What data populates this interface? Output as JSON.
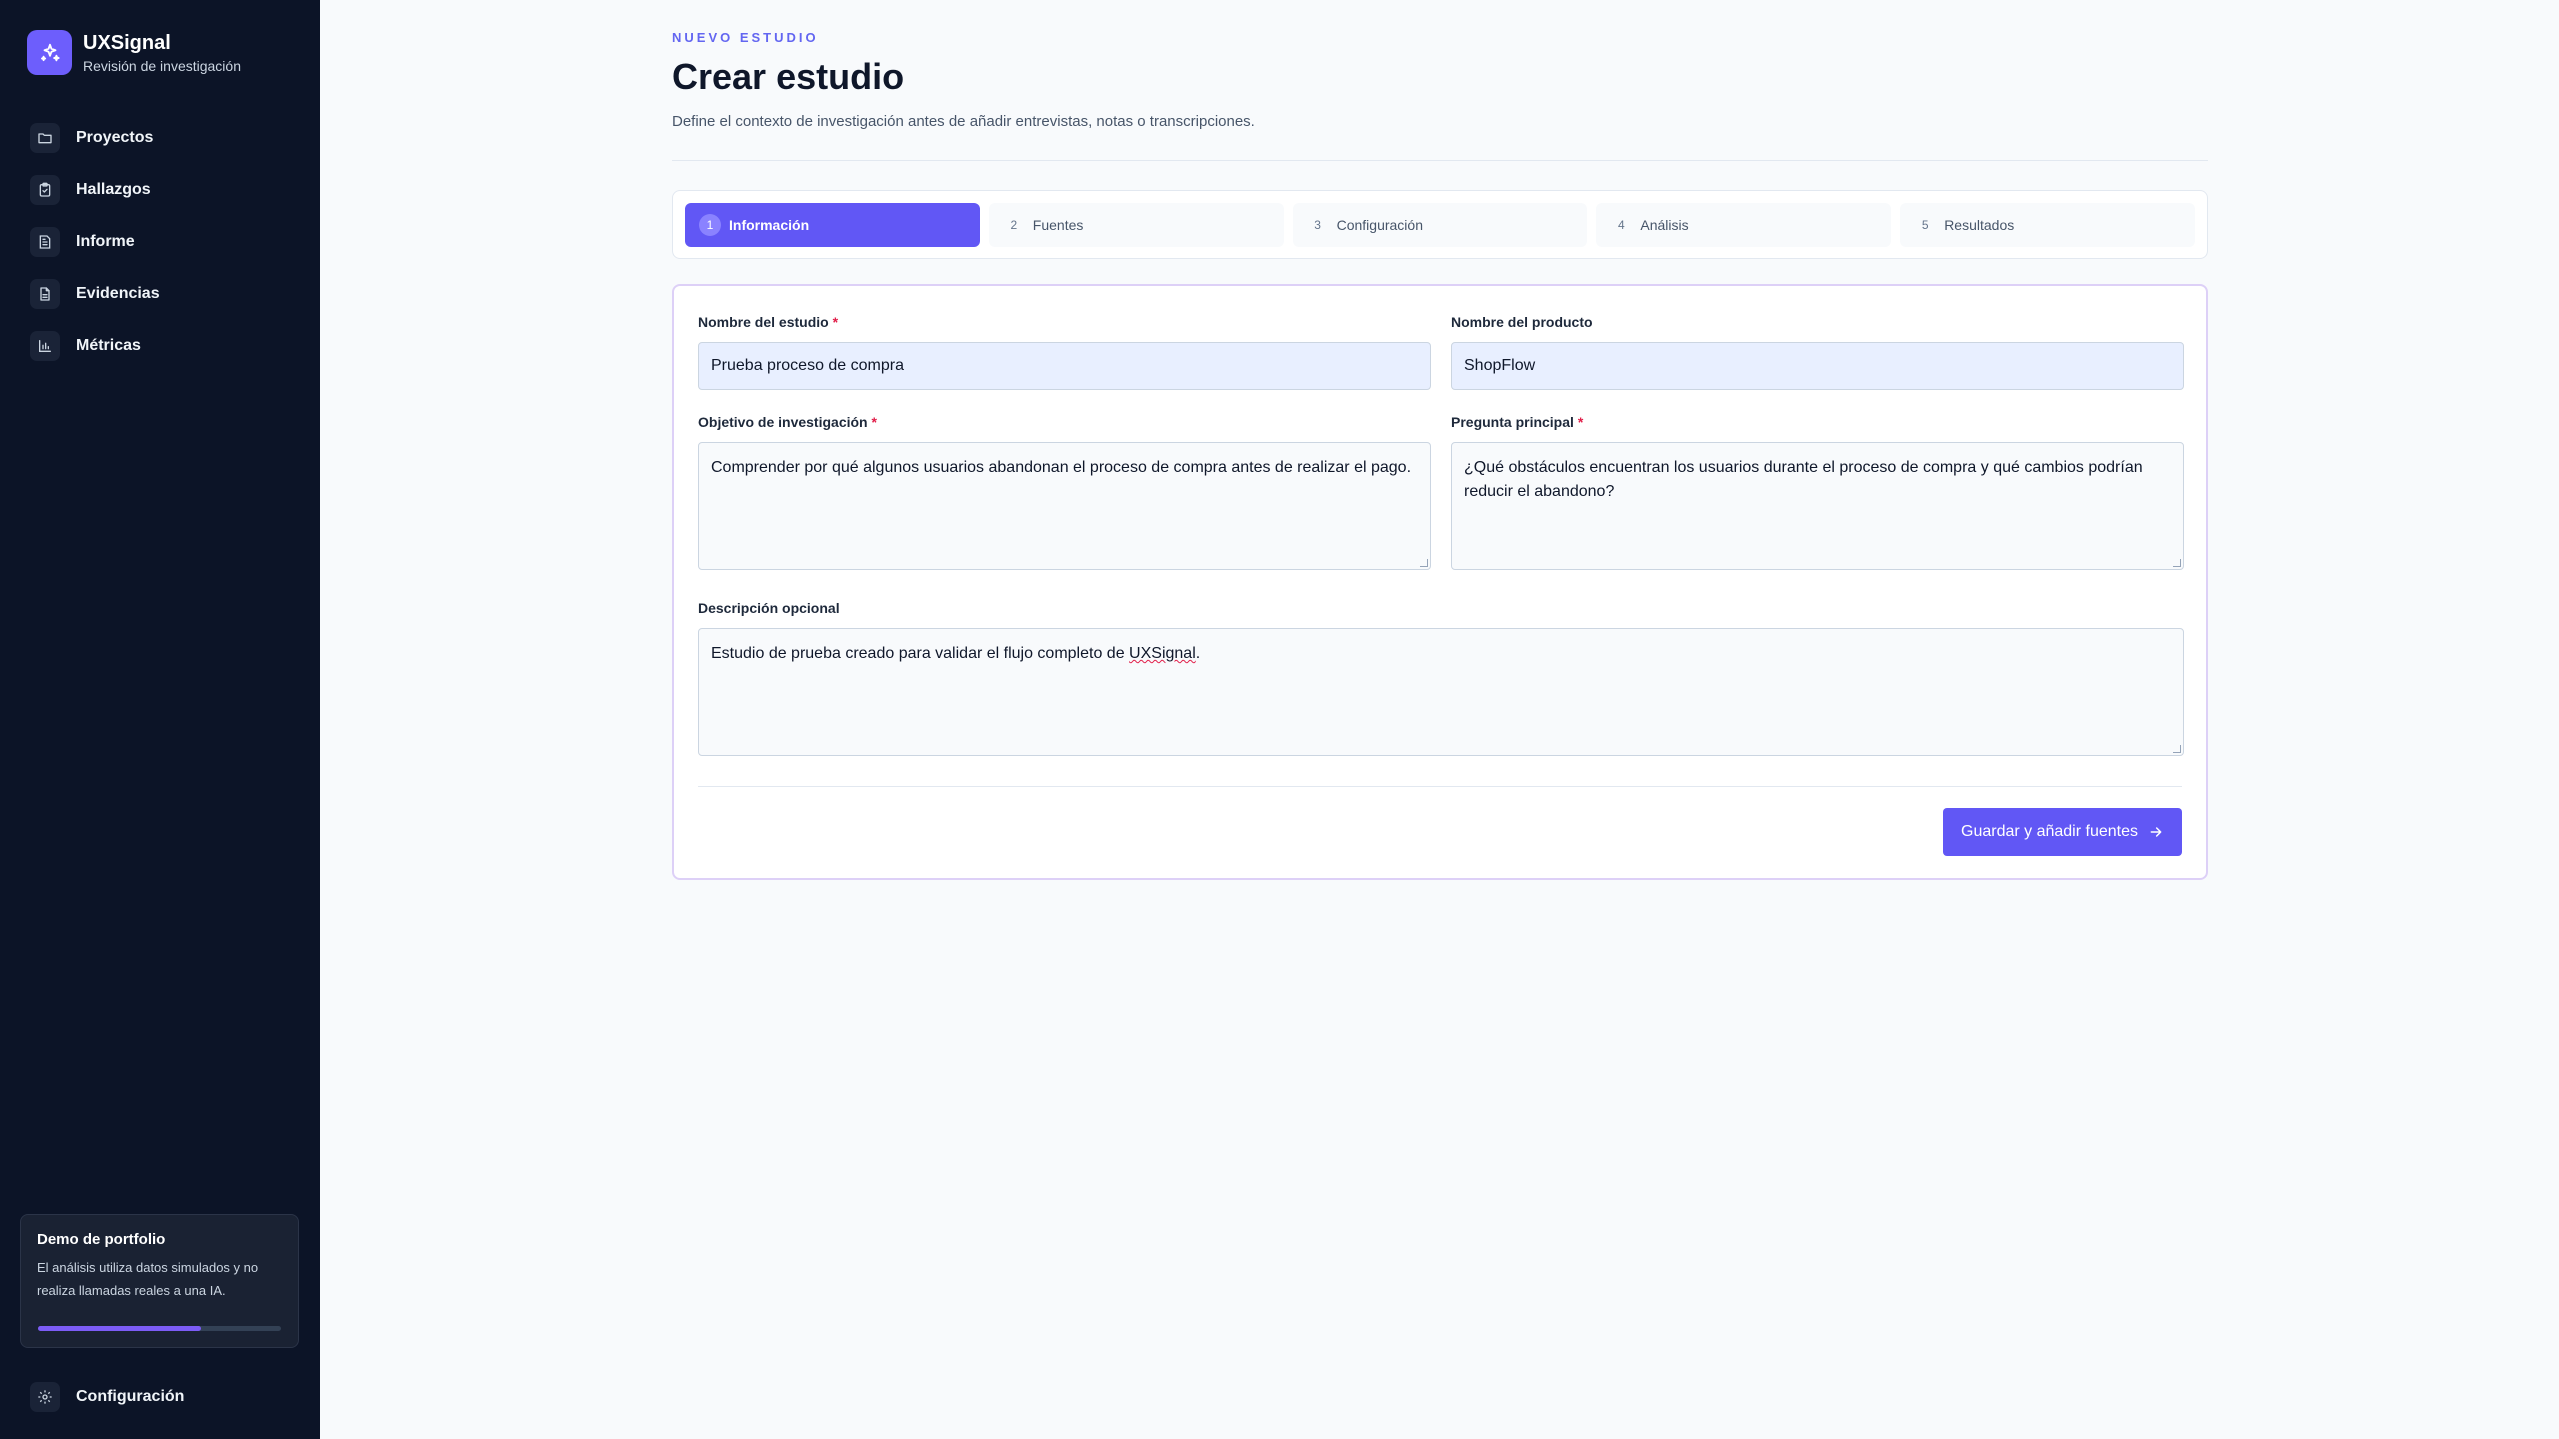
{
  "brand": {
    "name": "UXSignal",
    "subtitle": "Revisión de investigación"
  },
  "sidebar": {
    "items": [
      {
        "label": "Proyectos",
        "icon": "folder-icon"
      },
      {
        "label": "Hallazgos",
        "icon": "clipboard-check-icon"
      },
      {
        "label": "Informe",
        "icon": "report-icon"
      },
      {
        "label": "Evidencias",
        "icon": "document-icon"
      },
      {
        "label": "Métricas",
        "icon": "bar-chart-icon"
      }
    ],
    "demo": {
      "title": "Demo de portfolio",
      "text": "El análisis utiliza datos simulados y no realiza llamadas reales a una IA.",
      "progress": 0.67
    },
    "settings_label": "Configuración"
  },
  "page": {
    "eyebrow": "NUEVO ESTUDIO",
    "title": "Crear estudio",
    "subtitle": "Define el contexto de investigación antes de añadir entrevistas, notas o transcripciones."
  },
  "stepper": {
    "steps": [
      {
        "num": "1",
        "label": "Información",
        "active": true
      },
      {
        "num": "2",
        "label": "Fuentes",
        "active": false
      },
      {
        "num": "3",
        "label": "Configuración",
        "active": false
      },
      {
        "num": "4",
        "label": "Análisis",
        "active": false
      },
      {
        "num": "5",
        "label": "Resultados",
        "active": false
      }
    ]
  },
  "form": {
    "study_name": {
      "label": "Nombre del estudio",
      "required": "*",
      "value": "Prueba proceso de compra"
    },
    "product_name": {
      "label": "Nombre del producto",
      "value": "ShopFlow"
    },
    "objective": {
      "label": "Objetivo de investigación",
      "required": "*",
      "value": "Comprender por qué algunos usuarios abandonan el proceso de compra antes de realizar el pago."
    },
    "main_question": {
      "label": "Pregunta principal",
      "required": "*",
      "value": "¿Qué obstáculos encuentran los usuarios durante el proceso de compra y qué cambios podrían reducir el abandono?"
    },
    "description": {
      "label": "Descripción opcional",
      "value_before": "Estudio de prueba creado para validar el flujo completo de ",
      "value_flagged": "UXSignal",
      "value_after": "."
    },
    "submit_label": "Guardar y añadir fuentes"
  },
  "colors": {
    "accent": "#6157f5",
    "sidebar_bg": "#0c1427",
    "required": "#e11d48"
  }
}
